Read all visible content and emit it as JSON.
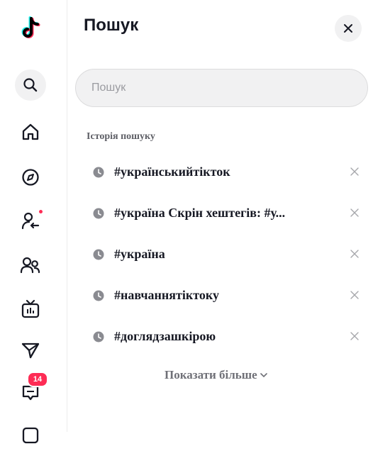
{
  "sidebar": {
    "logo_icon": "tiktok-logo",
    "items": [
      {
        "id": "search",
        "icon": "search-icon",
        "active": true
      },
      {
        "id": "home",
        "icon": "home-icon"
      },
      {
        "id": "explore",
        "icon": "compass-icon"
      },
      {
        "id": "following",
        "icon": "follow-user-icon",
        "dot": true
      },
      {
        "id": "friends",
        "icon": "friends-icon"
      },
      {
        "id": "live",
        "icon": "live-tv-icon"
      },
      {
        "id": "messages",
        "icon": "send-icon"
      },
      {
        "id": "inbox",
        "icon": "inbox-icon",
        "badge": "14"
      },
      {
        "id": "more",
        "icon": "more-icon"
      }
    ],
    "inbox_badge": "14"
  },
  "search_panel": {
    "title": "Пошук",
    "close_icon": "close-icon",
    "search": {
      "placeholder": "Пошук",
      "value": ""
    },
    "history_label": "Історія пошуку",
    "history": [
      {
        "text": "#українськийтікток"
      },
      {
        "text": "#україна Скрін хештегів: #у..."
      },
      {
        "text": "#україна"
      },
      {
        "text": "#навчаннятіктоку"
      },
      {
        "text": "#доглядзашкірою"
      }
    ],
    "show_more": "Показати більше"
  },
  "colors": {
    "accent": "#fe2c55",
    "text": "#161823",
    "muted": "#9a9ba0",
    "surface": "#f1f1f2"
  }
}
